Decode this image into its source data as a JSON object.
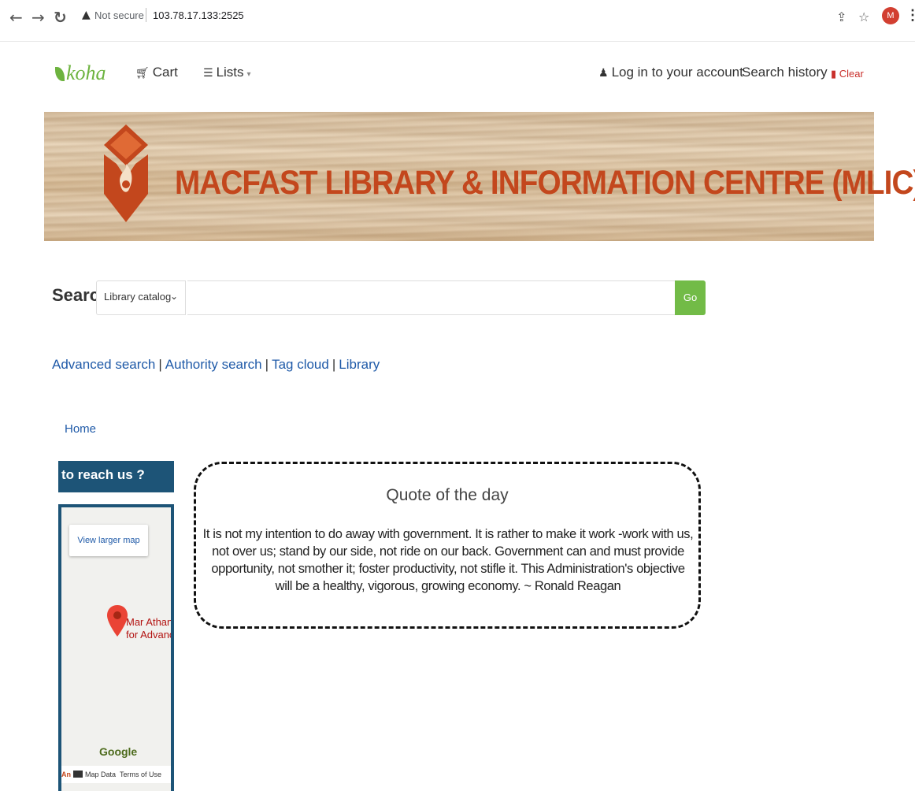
{
  "browser": {
    "security_label": "Not secure",
    "url": "103.78.17.133:2525",
    "avatar_letter": "M"
  },
  "navbar": {
    "logo": "koha",
    "cart_label": "Cart",
    "lists_label": "Lists",
    "login_label": "Log in to your account",
    "search_history_label": "Search history",
    "clear_label": "Clear"
  },
  "banner": {
    "title": "MACFAST LIBRARY & INFORMATION CENTRE (MLIC)",
    "title_color": "#c3471d"
  },
  "search": {
    "label": "Search",
    "scope_selected": "Library catalog",
    "query": "",
    "go_label": "Go",
    "go_color": "#72bb47"
  },
  "more_searches": [
    "Advanced search",
    "Authority search",
    "Tag cloud",
    "Library"
  ],
  "breadcrumb": {
    "home": "Home"
  },
  "sidebar": {
    "heading": "to reach us ?",
    "map": {
      "view_larger_label": "View larger map",
      "place_line1": "Mar Athana",
      "place_line2": "for Advanc",
      "google_label": "Google",
      "footer_prefix": "An",
      "map_data_label": "Map Data",
      "terms_label": "Terms of Use"
    }
  },
  "quote": {
    "title": "Quote of the day",
    "text": "It is not my intention to do away with government. It is rather to make it work -work with us, not over us; stand by our side, not ride on our back. Government can and must provide opportunity, not smother it; foster productivity, not stifle it. This Administration's objective will be a healthy, vigorous, growing economy. ~ Ronald Reagan"
  }
}
